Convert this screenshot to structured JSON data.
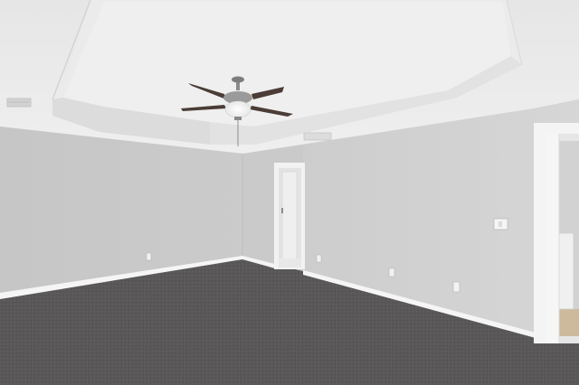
{
  "scene": {
    "description_tags": [
      "empty-bedroom",
      "tray-ceiling",
      "ceiling-fan",
      "carpet-floor",
      "open-doorways"
    ],
    "colors": {
      "ceiling": "#e9e9e9",
      "tray_inner": "#ececec",
      "left_wall": "#c9c9c9",
      "back_wall": "#cfcfcf",
      "right_wall": "#d2d2d2",
      "carpet": "#5f5c5d",
      "baseboard": "#f4f4f4",
      "door_trim": "#f2f2f2",
      "fan_blade": "#4a3c36",
      "fan_metal": "#8a8a8a"
    }
  }
}
